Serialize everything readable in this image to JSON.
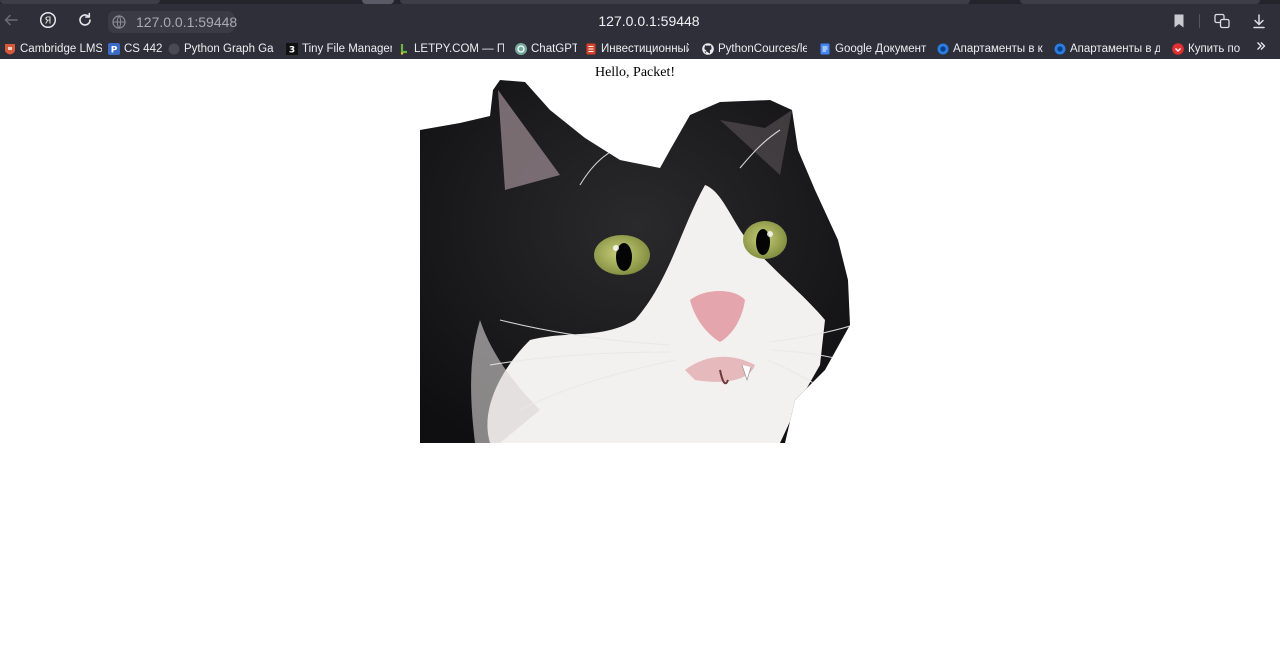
{
  "browser": {
    "address": "127.0.0.1:59448",
    "page_title": "127.0.0.1:59448"
  },
  "bookmarks": [
    {
      "label": "Cambridge LMS",
      "icon": "cambridge-icon",
      "color": "#d65a3a"
    },
    {
      "label": "CS 442",
      "icon": "p-letter-icon",
      "color": "#3a6bc7"
    },
    {
      "label": "Python Graph Gallery",
      "icon": "dark-circle-icon",
      "color": "#4a4a52"
    },
    {
      "label": "Tiny File Manager",
      "icon": "tfm-icon",
      "color": "#111111"
    },
    {
      "label": "LETPY.COM — Программирование",
      "icon": "letpy-icon",
      "color": "#6cb33f"
    },
    {
      "label": "ChatGPT",
      "icon": "chatgpt-icon",
      "color": "#74aa9c"
    },
    {
      "label": "Инвестиционный",
      "icon": "document-red-icon",
      "color": "#d8412a"
    },
    {
      "label": "PythonCources/lessons",
      "icon": "github-icon",
      "color": "#ffffff"
    },
    {
      "label": "Google Документы",
      "icon": "google-docs-icon",
      "color": "#4285f4"
    },
    {
      "label": "Апартаменты в курортном",
      "icon": "blue-globe-icon",
      "color": "#2a7de1"
    },
    {
      "label": "Апартаменты в деревне",
      "icon": "blue-globe-icon",
      "color": "#2a7de1"
    },
    {
      "label": "Купить по",
      "icon": "red-circle-icon",
      "color": "#e03030"
    }
  ],
  "page": {
    "heading": "Hello, Packet!",
    "image_subject": "black-and-white-cat-photo"
  }
}
